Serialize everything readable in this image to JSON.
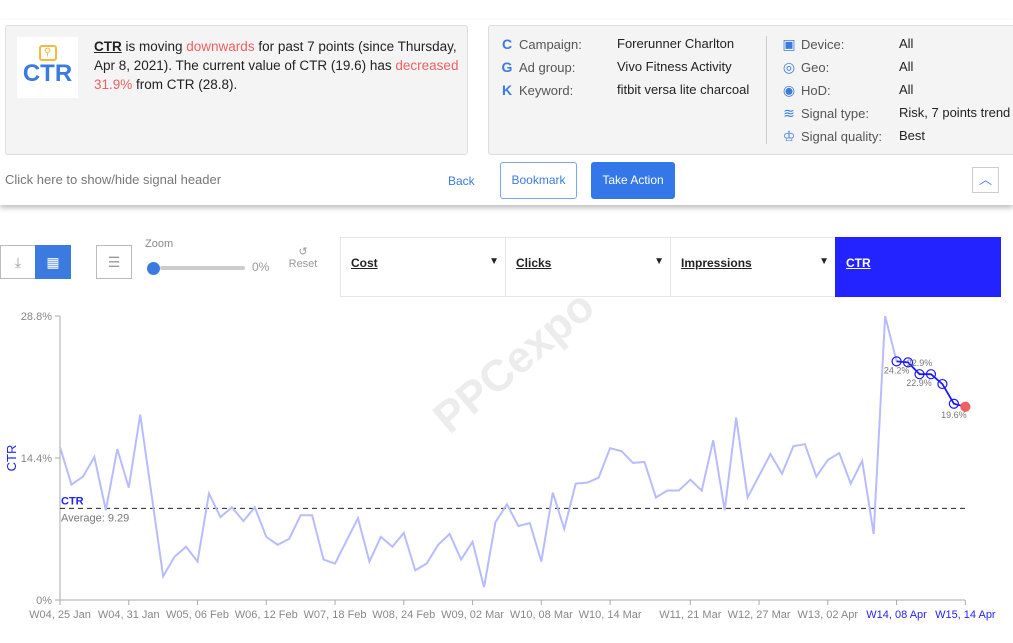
{
  "signal": {
    "logo_text": "CTR",
    "metric": "CTR",
    "t1": " is moving ",
    "direction": "downwards",
    "t2": " for past 7 points (since Thursday, Apr 8, 2021). The current value of CTR (19.6) has ",
    "change": "decreased 31.9%",
    "t3": " from CTR (28.8)."
  },
  "details": {
    "left": [
      {
        "icon": "C",
        "label": "Campaign:",
        "value": "Forerunner Charlton"
      },
      {
        "icon": "G",
        "label": "Ad group:",
        "value": "Vivo Fitness Activity"
      },
      {
        "icon": "K",
        "label": "Keyword:",
        "value": "fitbit versa lite charcoal"
      }
    ],
    "right": [
      {
        "icon": "device-icon",
        "glyph": "▣",
        "label": "Device:",
        "value": "All"
      },
      {
        "icon": "geo-pin-icon",
        "glyph": "◎",
        "label": "Geo:",
        "value": "All"
      },
      {
        "icon": "clock-play-icon",
        "glyph": "◉",
        "label": "HoD:",
        "value": "All"
      },
      {
        "icon": "signal-icon",
        "glyph": "≋",
        "label": "Signal type:",
        "value": "Risk, 7 points trend"
      },
      {
        "icon": "trophy-icon",
        "glyph": "♔",
        "label": "Signal quality:",
        "value": "Best"
      }
    ]
  },
  "actions": {
    "toggle": "Click here to show/hide signal header",
    "back": "Back",
    "bookmark": "Bookmark",
    "take_action": "Take Action",
    "collapse": "^"
  },
  "toolbar": {
    "zoom_label": "Zoom",
    "zoom_value": "0%",
    "reset": "Reset",
    "reset_icon": "↺"
  },
  "metric_tabs": [
    {
      "label": "Cost",
      "active": false
    },
    {
      "label": "Clicks",
      "active": false
    },
    {
      "label": "Impressions",
      "active": false
    },
    {
      "label": "CTR",
      "active": true
    }
  ],
  "watermark": "PPCexpo",
  "colors": {
    "accent": "#3b7be0",
    "series": "#b8bcff",
    "highlight": "#1a1aff",
    "negative": "#f06060",
    "active_tab": "#2323ff"
  },
  "chart_data": {
    "type": "line",
    "ylabel": "CTR",
    "ylim": [
      0,
      28.8
    ],
    "yticks": [
      "0%",
      "14.4%",
      "28.8%"
    ],
    "ytick_values": [
      0,
      14.4,
      28.8
    ],
    "average": {
      "label": "CTR",
      "text": "Average: 9.29",
      "value": 9.29
    },
    "values": [
      15.5,
      11.7,
      12.5,
      14.5,
      9.1,
      15.3,
      11.4,
      18.8,
      10.6,
      2.4,
      4.4,
      5.4,
      3.9,
      10.8,
      8.4,
      9.4,
      8.0,
      9.4,
      6.4,
      5.6,
      6.2,
      8.6,
      8.6,
      4.1,
      3.7,
      6.0,
      8.3,
      3.9,
      6.4,
      5.4,
      6.8,
      3.0,
      3.7,
      5.6,
      6.7,
      4.1,
      5.9,
      1.3,
      7.9,
      9.7,
      7.5,
      7.8,
      3.9,
      10.9,
      7.2,
      11.8,
      11.9,
      12.4,
      15.4,
      15.1,
      13.9,
      14.0,
      10.4,
      11.1,
      11.1,
      12.2,
      11.1,
      16.2,
      9.1,
      18.5,
      10.4,
      12.6,
      14.8,
      12.8,
      15.6,
      15.8,
      12.5,
      14.2,
      14.9,
      11.8,
      14.1,
      6.7,
      28.8,
      24.2,
      24.1,
      22.9,
      22.9,
      21.9,
      19.9,
      19.6
    ],
    "trend_start_index": 73,
    "point_labels": [
      {
        "index": 73,
        "text": "24.2%"
      },
      {
        "index": 75,
        "text": "22.9%"
      },
      {
        "index": 76,
        "text": "22.9%"
      },
      {
        "index": 78,
        "text": "19.6%"
      }
    ],
    "xticks": [
      {
        "index": 0,
        "label": "W04, 25 Jan"
      },
      {
        "index": 6,
        "label": "W04, 31 Jan"
      },
      {
        "index": 12,
        "label": "W05, 06 Feb"
      },
      {
        "index": 18,
        "label": "W06, 12 Feb"
      },
      {
        "index": 24,
        "label": "W07, 18 Feb"
      },
      {
        "index": 30,
        "label": "W08, 24 Feb"
      },
      {
        "index": 36,
        "label": "W09, 02 Mar"
      },
      {
        "index": 42,
        "label": "W10, 08 Mar"
      },
      {
        "index": 48,
        "label": "W10, 14 Mar"
      },
      {
        "index": 55,
        "label": "W11, 21 Mar"
      },
      {
        "index": 61,
        "label": "W12, 27 Mar"
      },
      {
        "index": 67,
        "label": "W13, 02 Apr"
      },
      {
        "index": 73,
        "label": "W14, 08 Apr",
        "highlight": true
      },
      {
        "index": 79,
        "label": "W15, 14 Apr",
        "highlight": true
      }
    ]
  }
}
